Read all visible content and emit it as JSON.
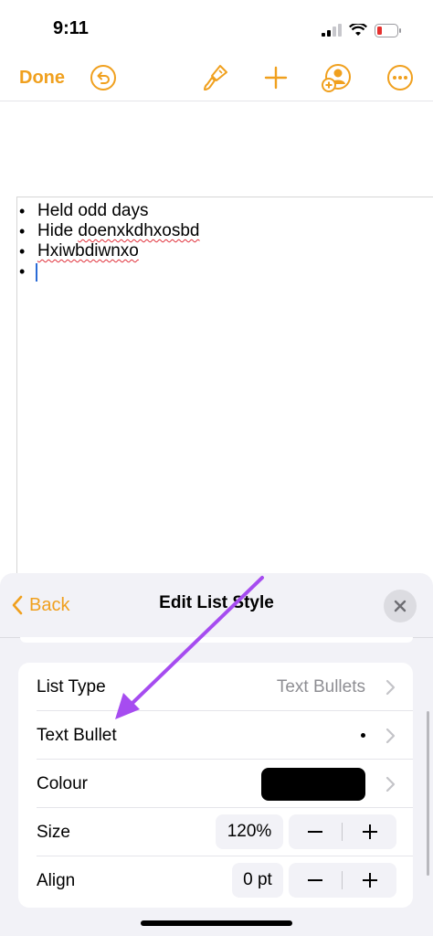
{
  "status": {
    "time": "9:11"
  },
  "toolbar": {
    "done_label": "Done",
    "icons": [
      "undo-icon",
      "paintbrush-icon",
      "plus-icon",
      "add-person-icon",
      "more-icon"
    ]
  },
  "document": {
    "items": [
      {
        "prefix": "Held odd days",
        "misspelled": ""
      },
      {
        "prefix": "Hide ",
        "misspelled": "doenxkdhxosbd"
      },
      {
        "prefix": "",
        "misspelled": "Hxiwbdiwnxo"
      },
      {
        "prefix": "",
        "misspelled": ""
      }
    ]
  },
  "panel": {
    "back_label": "Back",
    "title": "Edit List Style",
    "rows": [
      {
        "label": "List Type",
        "value": "Text Bullets"
      },
      {
        "label": "Text Bullet",
        "value": "•"
      },
      {
        "label": "Colour",
        "value_color": "#000000"
      },
      {
        "label": "Size",
        "value": "120%"
      },
      {
        "label": "Align",
        "value": "0 pt"
      }
    ]
  },
  "colors": {
    "accent": "#f0a01e",
    "annotation_arrow": "#a64cf0",
    "spellcheck": "#e0303a",
    "cursor": "#2a6bd6"
  }
}
